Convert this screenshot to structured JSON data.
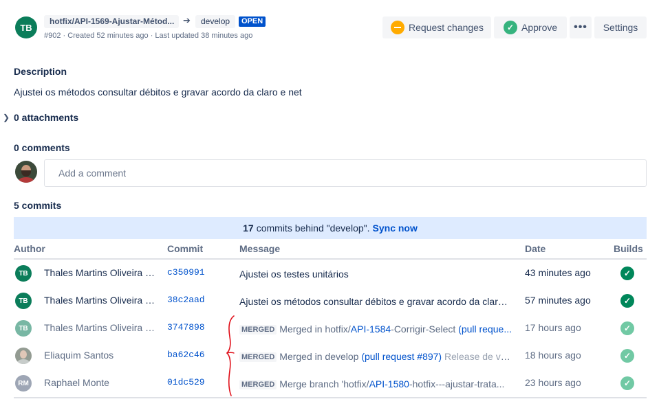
{
  "header": {
    "avatar_initials": "TB",
    "source_branch": "hotfix/API-1569-Ajustar-Métod...",
    "dest_branch": "develop",
    "status": "OPEN",
    "meta": "#902 · Created 52 minutes ago · Last updated 38 minutes ago",
    "request_changes_label": "Request changes",
    "approve_label": "Approve",
    "more_label": "•••",
    "settings_label": "Settings"
  },
  "description": {
    "title": "Description",
    "text": "Ajustei os métodos consultar débitos e gravar acordo da claro e net"
  },
  "attachments": {
    "label": "0 attachments"
  },
  "comments": {
    "label": "0 comments",
    "placeholder": "Add a comment"
  },
  "commits": {
    "label": "5 commits",
    "sync_count": "17",
    "sync_text": "commits behind \"develop\".",
    "sync_link": "Sync now",
    "headers": {
      "author": "Author",
      "commit": "Commit",
      "message": "Message",
      "date": "Date",
      "builds": "Builds"
    },
    "rows": [
      {
        "initials": "TB",
        "author": "Thales Martins Oliveira B...",
        "hash": "c350991",
        "message": "Ajustei os testes unitários",
        "date": "43 minutes ago"
      },
      {
        "initials": "TB",
        "author": "Thales Martins Oliveira B...",
        "hash": "38c2aad",
        "message": "Ajustei os métodos consultar débitos e gravar acordo da claro ...",
        "date": "57 minutes ago"
      },
      {
        "initials": "TB",
        "author": "Thales Martins Oliveira B...",
        "hash": "3747898",
        "badge": "MERGED",
        "msg_a": "Merged in hotfix/",
        "msg_link1": "API-1584",
        "msg_b": "-Corrigir-Select ",
        "msg_link2": "(pull reque...",
        "date": "17 hours ago"
      },
      {
        "initials": "",
        "author": "Eliaquim Santos",
        "hash": "ba62c46",
        "badge": "MERGED",
        "msg_a": "Merged in develop ",
        "msg_link": "(pull request #897)",
        "msg_muted": " Release de ver...",
        "date": "18 hours ago"
      },
      {
        "initials": "RM",
        "author": "Raphael Monte",
        "hash": "01dc529",
        "badge": "MERGED",
        "msg_a": "Merge branch 'hotfix/",
        "msg_link": "API-1580",
        "msg_b": "-hotfix---ajustar-trata...",
        "date": "23 hours ago"
      }
    ]
  },
  "colors": {
    "accent": "#0052cc",
    "success": "#00875a",
    "warning": "#ffab00",
    "annotation": "#e0101a"
  }
}
